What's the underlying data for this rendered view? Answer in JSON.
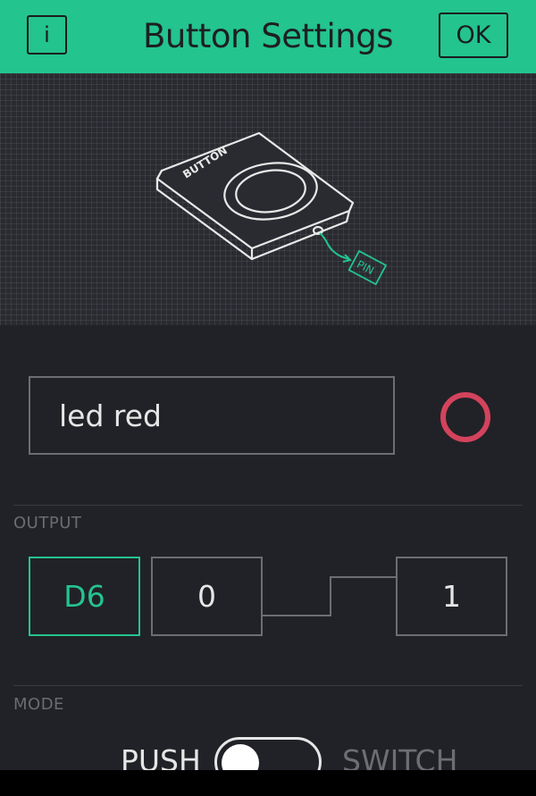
{
  "header": {
    "info_label": "i",
    "title": "Button Settings",
    "ok_label": "OK"
  },
  "preview": {
    "device_label": "BUTTON",
    "pin_label": "PIN"
  },
  "name_field": {
    "value": "led red"
  },
  "color_picker": {
    "color": "#d3435c"
  },
  "output": {
    "label": "OUTPUT",
    "pin": "D6",
    "low_value": "0",
    "high_value": "1"
  },
  "mode": {
    "label": "MODE",
    "push_label": "PUSH",
    "switch_label": "SWITCH",
    "selected": "PUSH"
  },
  "colors": {
    "accent": "#23c48e",
    "background": "#212227",
    "picker": "#d3435c"
  }
}
